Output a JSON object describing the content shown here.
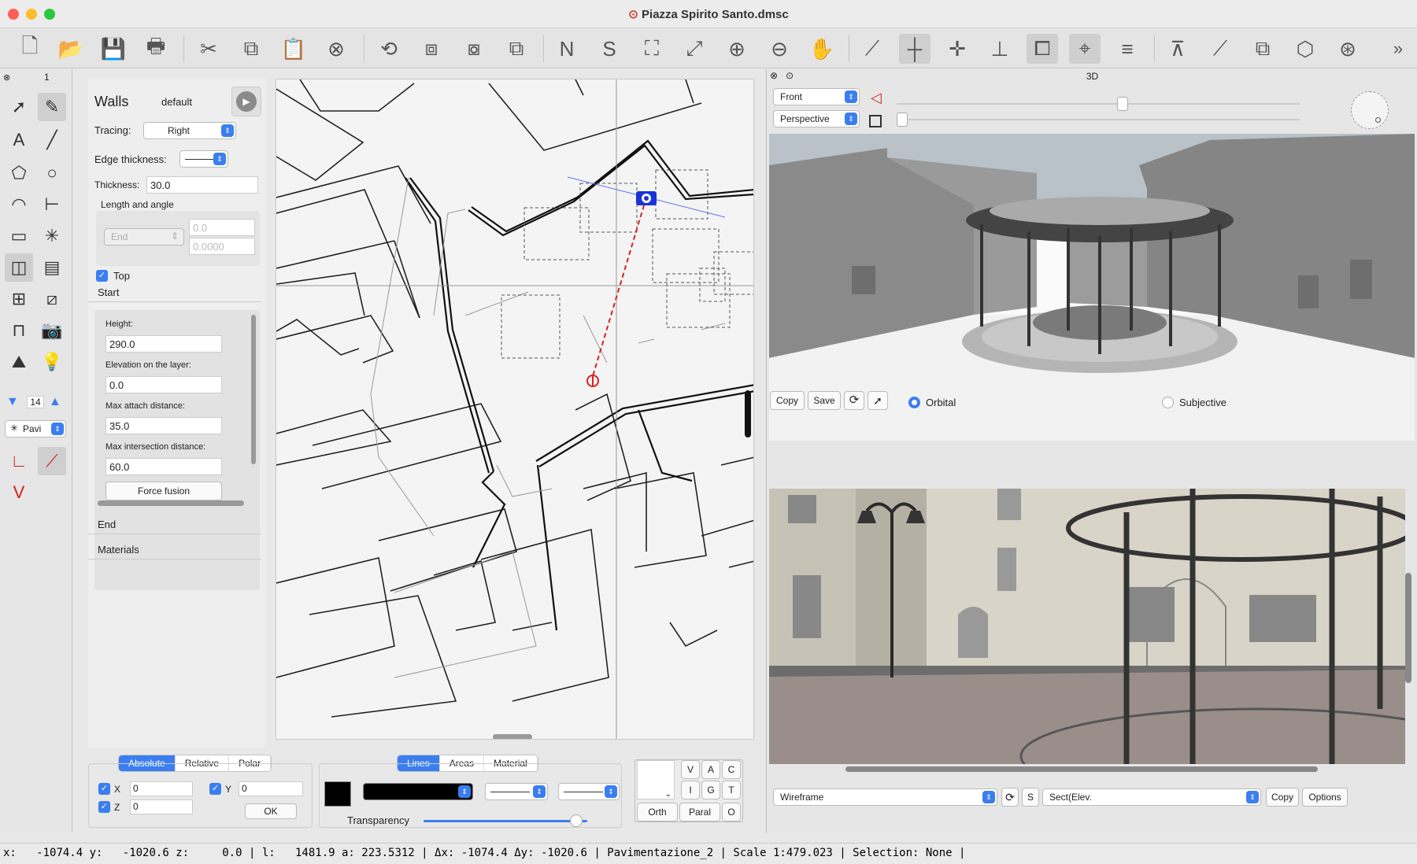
{
  "window": {
    "title": "Piazza Spirito Santo.dmsc"
  },
  "toolbar": {
    "items": [
      "new-file",
      "open-folder",
      "save",
      "print",
      "cut",
      "copy",
      "paste",
      "delete",
      "rotate",
      "group",
      "ungroup",
      "arrange",
      "north",
      "south",
      "fit-selection",
      "fit-all",
      "zoom-in",
      "zoom-out",
      "pan-hand",
      "line-tool",
      "crosshair",
      "snap-origin",
      "dimensions",
      "layers",
      "select-pointer",
      "lines",
      "wall-tool",
      "elevation",
      "stack",
      "cube",
      "wheel"
    ],
    "more": "»"
  },
  "panel_tab": "1",
  "walls": {
    "title": "Walls",
    "preset": "default",
    "tracing_label": "Tracing:",
    "tracing_value": "Right",
    "edge_thickness_label": "Edge thickness:",
    "thickness_label": "Thickness:",
    "thickness_value": "30.0",
    "length_angle_label": "Length and angle",
    "end_select": "End",
    "length_value": "0.0",
    "angle_value": "0.0000",
    "top_label": "Top",
    "start_section": "Start",
    "height_label": "Height:",
    "height_value": "290.0",
    "elevation_label": "Elevation on the layer:",
    "elevation_value": "0.0",
    "max_attach_label": "Max attach distance:",
    "max_attach_value": "35.0",
    "max_intersection_label": "Max intersection distance:",
    "max_intersection_value": "60.0",
    "force_fusion": "Force fusion",
    "end_section": "End",
    "materials_section": "Materials"
  },
  "layer_stepper": {
    "value": "14"
  },
  "pattern_select": {
    "value": "Pavi"
  },
  "coords": {
    "modes": [
      "Absolute",
      "Relative",
      "Polar"
    ],
    "x_label": "X",
    "x_value": "0",
    "y_label": "Y",
    "y_value": "0",
    "z_label": "Z",
    "z_value": "0",
    "ok": "OK"
  },
  "style": {
    "tabs": [
      "Lines",
      "Areas",
      "Material"
    ],
    "transparency_label": "Transparency",
    "transparency": 0.97
  },
  "view_buttons": {
    "grid": [
      "V",
      "A",
      "C",
      "I",
      "G",
      "T"
    ],
    "orth": "Orth",
    "paral": "Paral",
    "o": "O"
  },
  "view3d": {
    "header": "3D",
    "view_select": "Front",
    "projection_select": "Perspective",
    "copy": "Copy",
    "save": "Save",
    "orbital": "Orbital",
    "subjective": "Subjective",
    "slider1": 0.56,
    "slider2": 0.0
  },
  "bottom_view": {
    "render_select": "Wireframe",
    "s_button": "S",
    "section_select": "Sect(Elev.",
    "copy": "Copy",
    "options": "Options"
  },
  "status": {
    "x_label": "x:",
    "x": "-1074.4",
    "y_label": "y:",
    "y": "-1020.6",
    "z_label": "z:",
    "z": "0.0",
    "l_label": "l:",
    "l": "1481.9",
    "a_label": "a:",
    "a": "223.5312",
    "dx_label": "Δx:",
    "dx": "-1074.4",
    "dy_label": "Δy:",
    "dy": "-1020.6",
    "layer": "Pavimentazione_2",
    "scale": "Scale 1:479.023",
    "selection": "Selection: None"
  },
  "colors": {
    "accent": "#3a7ef0",
    "camera": "#1a33d8",
    "target": "#d92020"
  }
}
